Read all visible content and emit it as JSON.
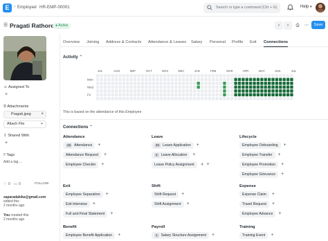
{
  "topbar": {
    "logo": "E",
    "breadcrumb": [
      "Employee",
      "HR-EMP-00001"
    ],
    "search_placeholder": "Search or type a command (Ctrl + G)",
    "help_label": "Help"
  },
  "header": {
    "title": "Pragati Rathore",
    "status": "Active",
    "save_label": "Save"
  },
  "sidebar": {
    "assigned_to": "Assigned To",
    "attachments": "Attachments",
    "attachment_file": "Pragati.jpeg",
    "attach_file": "Attach File",
    "shared_with": "Shared With",
    "tags": "Tags",
    "add_tag": "Add a tag ...",
    "likes": "0",
    "comments": "0",
    "follow": "FOLLOW",
    "activity": [
      {
        "user": "saparadakika@gmail.com",
        "action": "edited this",
        "time": "2 months ago"
      },
      {
        "user": "You",
        "action": "created this",
        "time": "2 months ago"
      }
    ]
  },
  "tabs": [
    "Overview",
    "Joining",
    "Address & Contacts",
    "Attendance & Leaves",
    "Salary",
    "Personal",
    "Profile",
    "Exit",
    "Connections"
  ],
  "activity": {
    "title": "Activity",
    "months": [
      "JUL",
      "AUG",
      "SEP",
      "OCT",
      "NOV",
      "DEC",
      "JAN",
      "FEB",
      "MAR",
      "APR",
      "MAY",
      "JUN",
      "JUL"
    ],
    "days": [
      "Mon",
      "Wed",
      "Fri"
    ],
    "note": "This is based on the attendance of this Employee"
  },
  "connections": {
    "title": "Connections",
    "groups": [
      {
        "name": "Attendance",
        "items": [
          {
            "label": "Attendance",
            "count": "26"
          },
          {
            "label": "Attendance Request"
          },
          {
            "label": "Employee Checkin"
          }
        ]
      },
      {
        "name": "Leave",
        "items": [
          {
            "label": "Leave Application",
            "count": "20"
          },
          {
            "label": "Leave Allocation",
            "count": "2"
          },
          {
            "label": "Leave Policy Assignment",
            "extra": "4"
          }
        ]
      },
      {
        "name": "Lifecycle",
        "items": [
          {
            "label": "Employee Onboarding"
          },
          {
            "label": "Employee Transfer"
          },
          {
            "label": "Employee Promotion"
          },
          {
            "label": "Employee Grievance"
          }
        ]
      },
      {
        "name": "Exit",
        "items": [
          {
            "label": "Employee Separation"
          },
          {
            "label": "Exit Interview"
          },
          {
            "label": "Full and Final Statement"
          }
        ]
      },
      {
        "name": "Shift",
        "items": [
          {
            "label": "Shift Request"
          },
          {
            "label": "Shift Assignment"
          }
        ]
      },
      {
        "name": "Expense",
        "items": [
          {
            "label": "Expense Claim"
          },
          {
            "label": "Travel Request"
          },
          {
            "label": "Employee Advance"
          }
        ]
      },
      {
        "name": "Benefit",
        "items": [
          {
            "label": "Employee Benefit Application"
          }
        ]
      },
      {
        "name": "Payroll",
        "items": [
          {
            "label": "Salary Structure Assignment",
            "count": "1"
          }
        ]
      },
      {
        "name": "Training",
        "items": [
          {
            "label": "Training Event"
          }
        ]
      }
    ]
  },
  "colors": {
    "accent": "#2490ef",
    "heat_empty": "#ebedf0",
    "heat_full": "#196b3a",
    "heat_mid": "#3b9d58"
  }
}
